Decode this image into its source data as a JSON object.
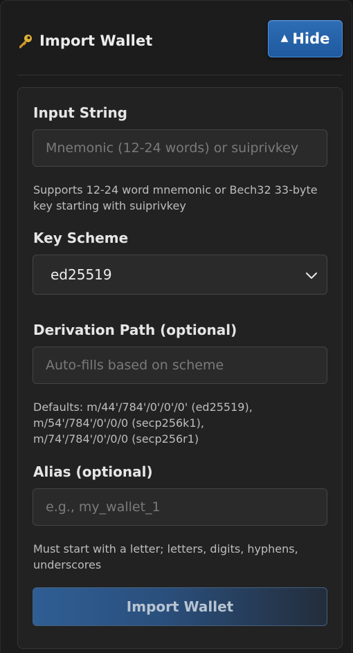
{
  "header": {
    "title": "Import Wallet",
    "hide_label": "Hide",
    "hide_icon": "triangle-up"
  },
  "form": {
    "input_string": {
      "label": "Input String",
      "value": "",
      "placeholder": "Mnemonic (12-24 words) or suiprivkey",
      "help": "Supports 12-24 word mnemonic or Bech32 33-byte key starting with suiprivkey"
    },
    "key_scheme": {
      "label": "Key Scheme",
      "selected": "ed25519"
    },
    "derivation_path": {
      "label": "Derivation Path (optional)",
      "value": "",
      "placeholder": "Auto-fills based on scheme",
      "help_line1": "Defaults: m/44'/784'/0'/0'/0' (ed25519),",
      "help_line2": "m/54'/784'/0'/0/0 (secp256k1),",
      "help_line3": "m/74'/784'/0'/0/0 (secp256r1)"
    },
    "alias": {
      "label": "Alias (optional)",
      "value": "",
      "placeholder": "e.g., my_wallet_1",
      "help": "Must start with a letter; letters, digits, hyphens, underscores"
    },
    "submit_label": "Import Wallet"
  },
  "colors": {
    "background": "#1c1c1c",
    "card": "#222222",
    "accent": "#2e6cb3",
    "key_icon": "#e0b03a"
  }
}
